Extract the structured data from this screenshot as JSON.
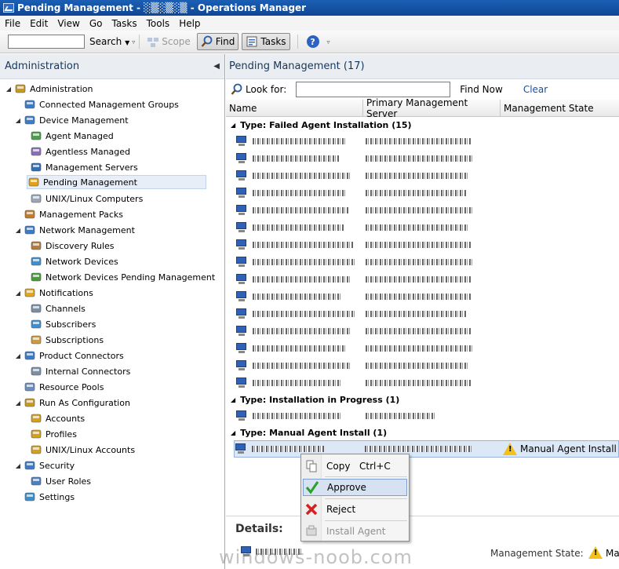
{
  "window": {
    "title": "Pending Management - ░▒░▒░▒ - Operations Manager"
  },
  "menubar": {
    "items": [
      "File",
      "Edit",
      "View",
      "Go",
      "Tasks",
      "Tools",
      "Help"
    ]
  },
  "toolbar": {
    "search_label": "Search",
    "scope_label": "Scope",
    "find_label": "Find",
    "tasks_label": "Tasks"
  },
  "nav": {
    "header": "Administration",
    "items": [
      {
        "label": "Administration",
        "level": 0,
        "expanded": true,
        "icon": "gear-icon"
      },
      {
        "label": "Connected Management Groups",
        "level": 1,
        "icon": "connected-groups-icon"
      },
      {
        "label": "Device Management",
        "level": 1,
        "expanded": true,
        "icon": "computers-icon"
      },
      {
        "label": "Agent Managed",
        "level": 2,
        "icon": "agent-managed-icon"
      },
      {
        "label": "Agentless Managed",
        "level": 2,
        "icon": "agentless-managed-icon"
      },
      {
        "label": "Management Servers",
        "level": 2,
        "icon": "management-servers-icon"
      },
      {
        "label": "Pending Management",
        "level": 2,
        "selected": true,
        "icon": "pending-management-icon"
      },
      {
        "label": "UNIX/Linux Computers",
        "level": 2,
        "icon": "unix-computer-icon"
      },
      {
        "label": "Management Packs",
        "level": 1,
        "icon": "management-packs-icon"
      },
      {
        "label": "Network Management",
        "level": 1,
        "expanded": true,
        "icon": "network-icon"
      },
      {
        "label": "Discovery Rules",
        "level": 2,
        "icon": "discovery-rules-icon"
      },
      {
        "label": "Network Devices",
        "level": 2,
        "icon": "network-devices-icon"
      },
      {
        "label": "Network Devices Pending Management",
        "level": 2,
        "icon": "network-pending-icon"
      },
      {
        "label": "Notifications",
        "level": 1,
        "expanded": true,
        "icon": "notifications-icon"
      },
      {
        "label": "Channels",
        "level": 2,
        "icon": "channels-icon"
      },
      {
        "label": "Subscribers",
        "level": 2,
        "icon": "subscribers-icon"
      },
      {
        "label": "Subscriptions",
        "level": 2,
        "icon": "subscriptions-icon"
      },
      {
        "label": "Product Connectors",
        "level": 1,
        "expanded": true,
        "icon": "product-connectors-icon"
      },
      {
        "label": "Internal Connectors",
        "level": 2,
        "icon": "internal-connectors-icon"
      },
      {
        "label": "Resource Pools",
        "level": 1,
        "icon": "resource-pools-icon"
      },
      {
        "label": "Run As Configuration",
        "level": 1,
        "expanded": true,
        "icon": "run-as-icon"
      },
      {
        "label": "Accounts",
        "level": 2,
        "icon": "accounts-icon"
      },
      {
        "label": "Profiles",
        "level": 2,
        "icon": "profiles-icon"
      },
      {
        "label": "UNIX/Linux Accounts",
        "level": 2,
        "icon": "unix-accounts-icon"
      },
      {
        "label": "Security",
        "level": 1,
        "expanded": true,
        "icon": "security-icon"
      },
      {
        "label": "User Roles",
        "level": 2,
        "icon": "user-roles-icon"
      },
      {
        "label": "Settings",
        "level": 1,
        "icon": "settings-icon"
      }
    ]
  },
  "main": {
    "title": "Pending Management (17)",
    "look_for_label": "Look for:",
    "look_for_value": "",
    "find_now_label": "Find Now",
    "clear_label": "Clear",
    "columns": [
      "Name",
      "Primary Management Server",
      "Management State"
    ],
    "groups": [
      {
        "label": "Type: Failed Agent Installation (15)",
        "row_count": 15
      },
      {
        "label": "Type: Installation in Progress (1)",
        "row_count": 1
      },
      {
        "label": "Type: Manual Agent Install (1)",
        "row_count": 1,
        "state": "Manual Agent Install"
      }
    ]
  },
  "context_menu": {
    "items": [
      {
        "label": "Copy",
        "shortcut": "Ctrl+C",
        "icon": "copy-icon",
        "enabled": true
      },
      {
        "label": "Approve",
        "icon": "checkmark-icon",
        "enabled": true,
        "highlighted": true
      },
      {
        "label": "Reject",
        "icon": "red-x-icon",
        "enabled": true
      },
      {
        "label": "Install Agent",
        "icon": "install-agent-icon",
        "enabled": false
      }
    ]
  },
  "details": {
    "header": "Details:",
    "management_state_label": "Management State:",
    "management_state_value": "Ma"
  },
  "watermark": "windows-noob.com",
  "colors": {
    "title_bar": "#1b5fb5",
    "selection": "#dde8f6",
    "warning": "#f2c21a",
    "approve_green": "#2aa02a",
    "reject_red": "#d42020"
  }
}
